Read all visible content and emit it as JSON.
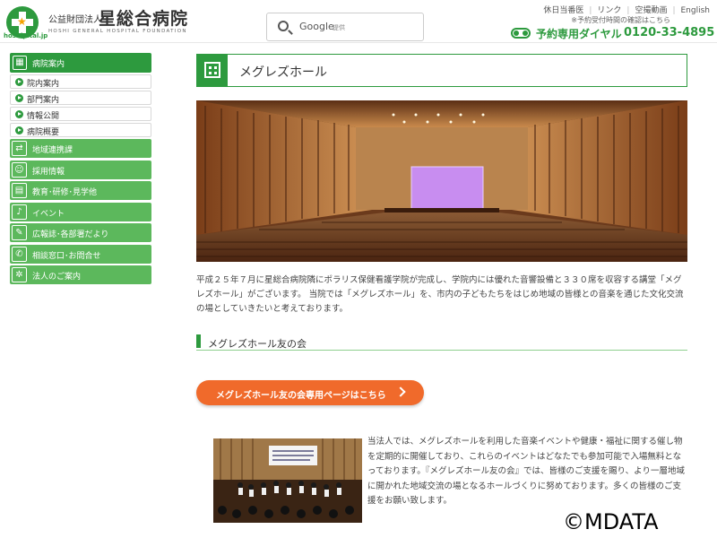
{
  "header": {
    "logo_domain": "hoshipital.jp",
    "org_type": "公益財団法人",
    "hospital_name": "星総合病院",
    "hospital_name_en": "HOSHI GENERAL HOSPITAL FOUNDATION",
    "search": {
      "brand": "Google",
      "powered": "提供"
    },
    "top_links": [
      "休日当番医",
      "リンク",
      "空撮動画",
      "English"
    ],
    "note": "※予約受付時間の確認はこちら",
    "phone": {
      "label": "予約専用ダイヤル",
      "number": "0120-33-4895"
    }
  },
  "sidebar": {
    "main": {
      "label": "病院案内",
      "icon": "building-icon"
    },
    "sub_items": [
      {
        "label": "院内案内"
      },
      {
        "label": "部門案内"
      },
      {
        "label": "情報公開"
      },
      {
        "label": "病院概要"
      }
    ],
    "categories": [
      {
        "label": "地域連携課",
        "icon": "handshake-icon",
        "glyph": "⇄"
      },
      {
        "label": "採用情報",
        "icon": "people-icon",
        "glyph": "☺"
      },
      {
        "label": "教育･研修･見学他",
        "icon": "book-icon",
        "glyph": "▤"
      },
      {
        "label": "イベント",
        "icon": "music-note-icon",
        "glyph": "♪"
      },
      {
        "label": "広報誌･各部署だより",
        "icon": "document-icon",
        "glyph": "✎"
      },
      {
        "label": "相談窓口･お問合せ",
        "icon": "chat-icon",
        "glyph": "✆"
      },
      {
        "label": "法人のご案内",
        "icon": "network-icon",
        "glyph": "✲"
      }
    ]
  },
  "main": {
    "title": "メグレズホール",
    "intro": "平成２５年７月に星総合病院隣にポラリス保健看護学院が完成し、学院内には優れた音響設備と３３０席を収容する講堂「メグレズホール」がございます。 当院では「メグレズホール」を、市内の子どもたちをはじめ地域の皆様との音楽を通じた文化交流の場としていきたいと考えております。",
    "section_title": "メグレズホール友の会",
    "cta_label": "メグレズホール友の会専用ページはこちら",
    "body": "当法人では、メグレズホールを利用した音楽イベントや健康・福祉に関する催し物を定期的に開催しており、これらのイベントはどなたでも参加可能で入場無料となっております。『メグレズホール友の会』では、皆様のご支援を賜り、より一層地域に開かれた地域交流の場となるホールづくりに努めております。多くの皆様のご支援をお願い致します。"
  },
  "watermark": "©MDATA",
  "colors": {
    "brand_green": "#2d9a3e",
    "light_green": "#5cb85c",
    "cta_orange": "#f06a2b"
  }
}
